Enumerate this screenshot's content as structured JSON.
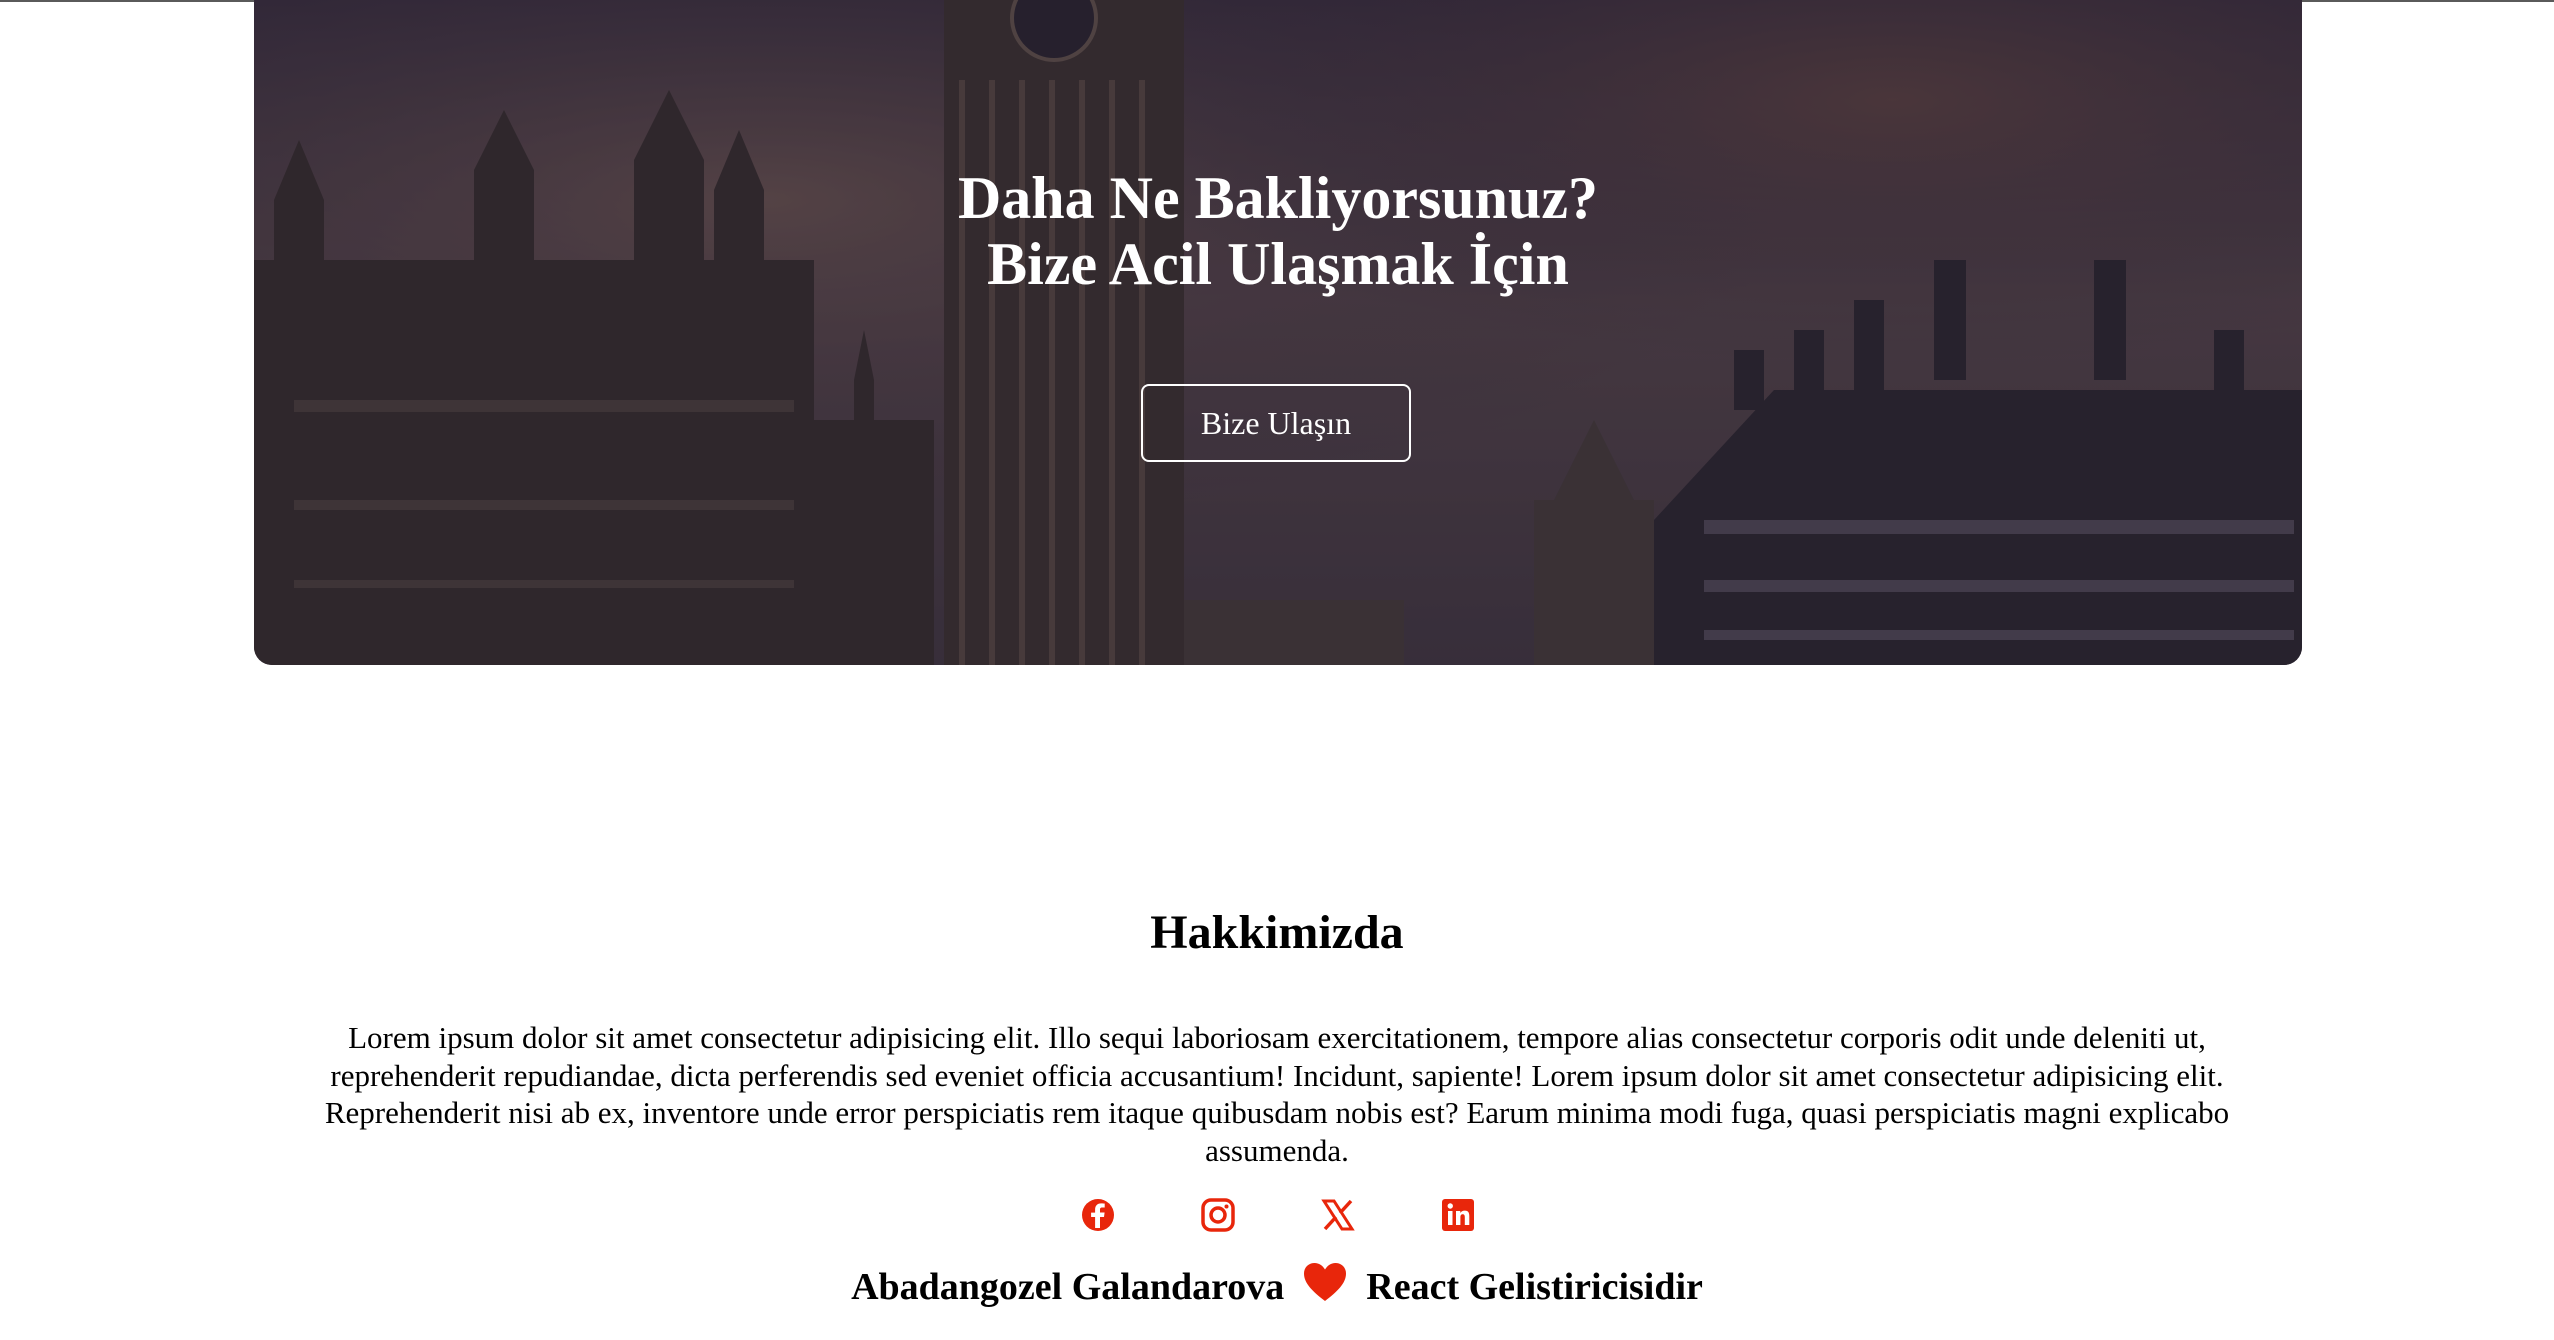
{
  "hero": {
    "title_line1": "Daha Ne Bakliyorsunuz?",
    "title_line2": "Bize Acil Ulaşmak İçin",
    "button_label": "Bize Ulaşın"
  },
  "about": {
    "heading": "Hakkimizda",
    "body": "Lorem ipsum dolor sit amet consectetur adipisicing elit. Illo sequi laboriosam exercitationem, tempore alias consectetur corporis odit unde deleniti ut, reprehenderit repudiandae, dicta perferendis sed eveniet officia accusantium! Incidunt, sapiente! Lorem ipsum dolor sit amet consectetur adipisicing elit. Reprehenderit nisi ab ex, inventore unde error perspiciatis rem itaque quibusdam nobis est? Earum minima modi fuga, quasi perspiciatis magni explicabo assumenda."
  },
  "socials": [
    {
      "icon": "facebook-icon"
    },
    {
      "icon": "instagram-icon"
    },
    {
      "icon": "x-icon"
    },
    {
      "icon": "linkedin-icon"
    }
  ],
  "credit": {
    "name": "Abadangozel Galandarova",
    "heart_icon": "heart-icon",
    "role": "React Gelistiricisidir"
  },
  "colors": {
    "accent": "#e8260b",
    "hero_overlay": "#2a2233",
    "text": "#000000"
  }
}
